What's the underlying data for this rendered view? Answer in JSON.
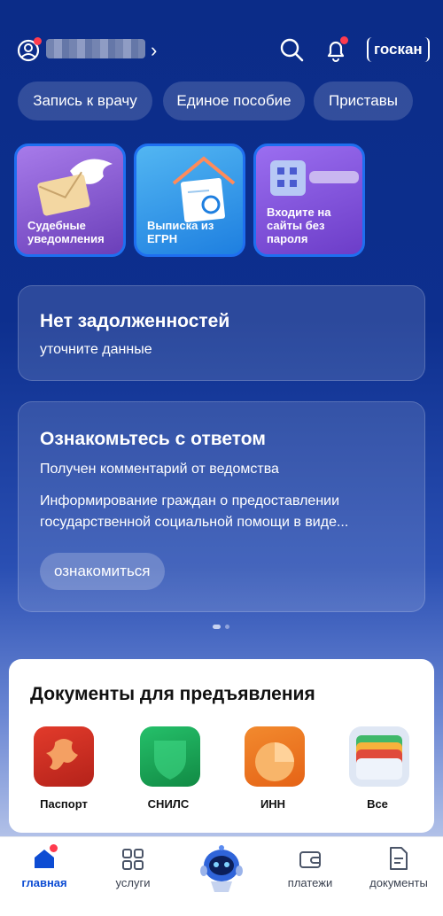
{
  "header": {
    "gosklyuch_label": "госкан",
    "user_chevron": "›"
  },
  "chips": [
    "Запись к врачу",
    "Единое пособие",
    "Приставы"
  ],
  "tiles": [
    {
      "label": "Судебные уведомления"
    },
    {
      "label": "Выписка из ЕГРН"
    },
    {
      "label": "Входите на сайты без пароля"
    }
  ],
  "debt_card": {
    "title": "Нет задолженностей",
    "subtitle": "уточните данные"
  },
  "answer_card": {
    "title": "Ознакомьтесь с ответом",
    "line1": "Получен комментарий от ведомства",
    "line2": "Информирование граждан о предоставлении государственной социальной помощи в виде...",
    "button": "ознакомиться"
  },
  "documents": {
    "title": "Документы для предъявления",
    "items": [
      {
        "label": "Паспорт",
        "icon": "passport-icon",
        "color": "#d63424"
      },
      {
        "label": "СНИЛС",
        "icon": "snils-icon",
        "color": "#16a34a"
      },
      {
        "label": "ИНН",
        "icon": "inn-icon",
        "color": "#f07a22"
      },
      {
        "label": "Все",
        "icon": "wallet-icon",
        "color": "#dfe7f4"
      }
    ]
  },
  "nav": [
    {
      "label": "главная",
      "active": true
    },
    {
      "label": "услуги"
    },
    {
      "label": ""
    },
    {
      "label": "платежи"
    },
    {
      "label": "документы"
    }
  ],
  "colors": {
    "accent": "#0d4cd3",
    "badge": "#ff3b4e"
  }
}
